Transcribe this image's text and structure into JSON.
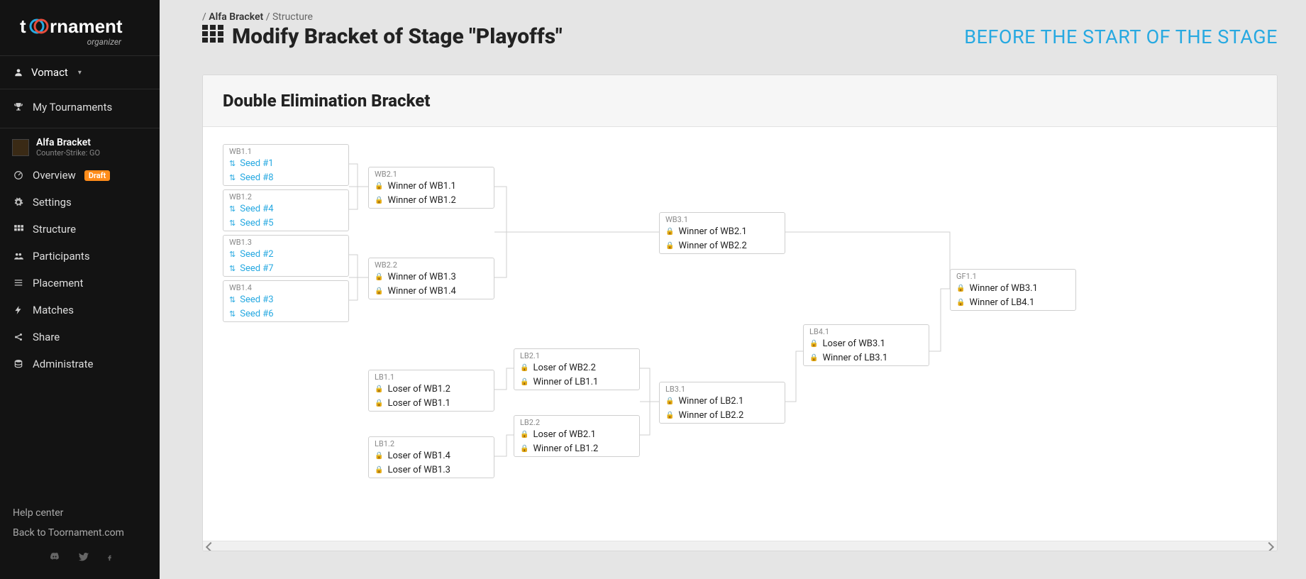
{
  "logo": {
    "text": "toornament",
    "sub": "organizer"
  },
  "user": {
    "name": "Vomact"
  },
  "nav": {
    "my_tournaments": "My Tournaments",
    "tournament": {
      "name": "Alfa Bracket",
      "game": "Counter-Strike: GO"
    },
    "items": {
      "overview": "Overview",
      "overview_badge": "Draft",
      "settings": "Settings",
      "structure": "Structure",
      "participants": "Participants",
      "placement": "Placement",
      "matches": "Matches",
      "share": "Share",
      "administrate": "Administrate"
    },
    "bottom": {
      "help": "Help center",
      "back": "Back to Toornament.com"
    }
  },
  "breadcrumb": {
    "sep1": "/ ",
    "link": "Alfa Bracket",
    "sep2": " / ",
    "tail": "Structure"
  },
  "page_title": "Modify Bracket of Stage \"Playoffs\"",
  "stage_status": "BEFORE THE START OF THE STAGE",
  "panel_title": "Double Elimination Bracket",
  "matches": {
    "wb11": {
      "head": "WB1.1",
      "a": "Seed #1",
      "b": "Seed #8"
    },
    "wb12": {
      "head": "WB1.2",
      "a": "Seed #4",
      "b": "Seed #5"
    },
    "wb13": {
      "head": "WB1.3",
      "a": "Seed #2",
      "b": "Seed #7"
    },
    "wb14": {
      "head": "WB1.4",
      "a": "Seed #3",
      "b": "Seed #6"
    },
    "wb21": {
      "head": "WB2.1",
      "a": "Winner of WB1.1",
      "b": "Winner of WB1.2"
    },
    "wb22": {
      "head": "WB2.2",
      "a": "Winner of WB1.3",
      "b": "Winner of WB1.4"
    },
    "wb31": {
      "head": "WB3.1",
      "a": "Winner of WB2.1",
      "b": "Winner of WB2.2"
    },
    "gf11": {
      "head": "GF1.1",
      "a": "Winner of WB3.1",
      "b": "Winner of LB4.1"
    },
    "lb11": {
      "head": "LB1.1",
      "a": "Loser of WB1.2",
      "b": "Loser of WB1.1"
    },
    "lb12": {
      "head": "LB1.2",
      "a": "Loser of WB1.4",
      "b": "Loser of WB1.3"
    },
    "lb21": {
      "head": "LB2.1",
      "a": "Loser of WB2.2",
      "b": "Winner of LB1.1"
    },
    "lb22": {
      "head": "LB2.2",
      "a": "Loser of WB2.1",
      "b": "Winner of LB1.2"
    },
    "lb31": {
      "head": "LB3.1",
      "a": "Winner of LB2.1",
      "b": "Winner of LB2.2"
    },
    "lb41": {
      "head": "LB4.1",
      "a": "Loser of WB3.1",
      "b": "Winner of LB3.1"
    }
  }
}
